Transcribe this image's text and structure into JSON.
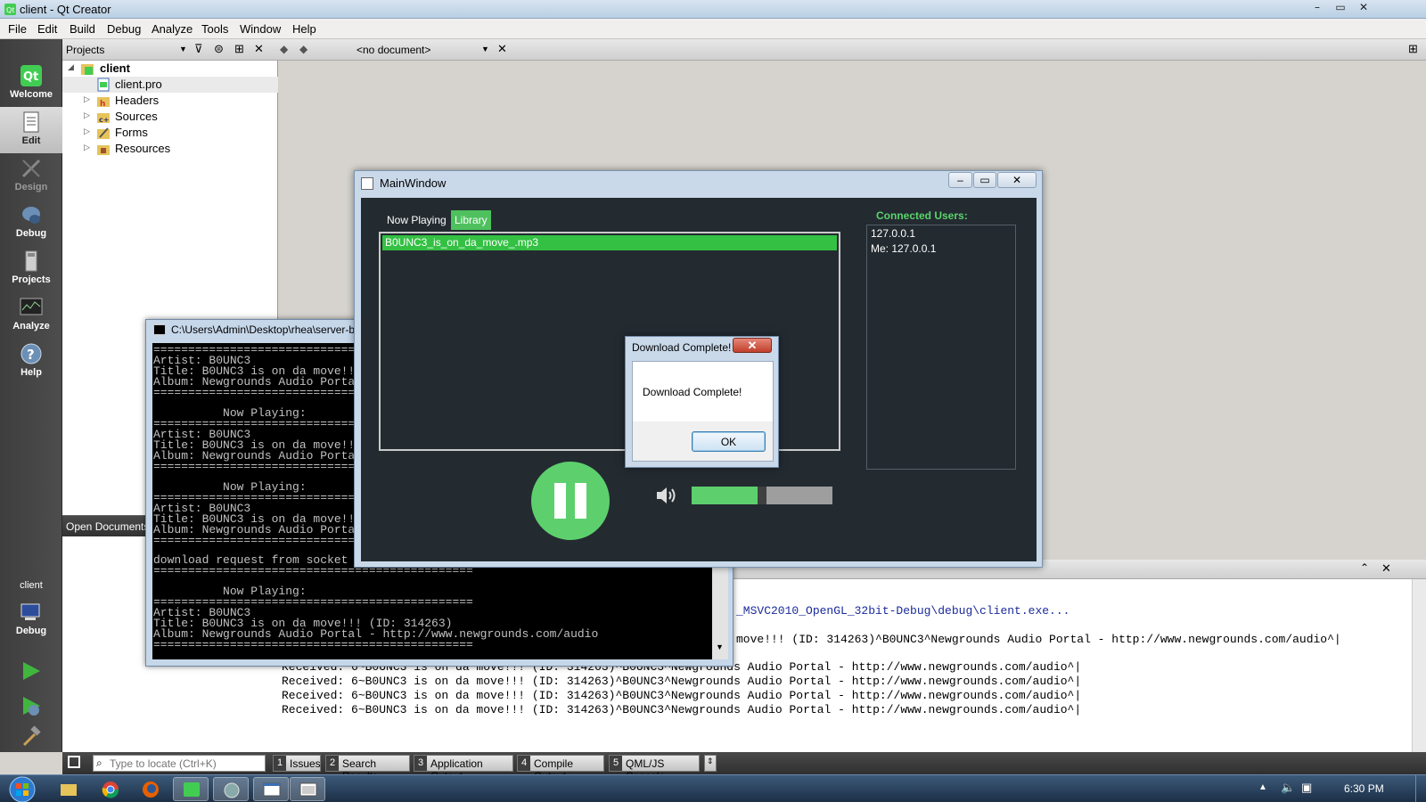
{
  "window": {
    "title": "client - Qt Creator",
    "minimize": "–",
    "maximize": "▭",
    "close": "✕"
  },
  "menu": [
    "File",
    "Edit",
    "Build",
    "Debug",
    "Analyze",
    "Tools",
    "Window",
    "Help"
  ],
  "modes": [
    "Welcome",
    "Edit",
    "Design",
    "Debug",
    "Projects",
    "Analyze",
    "Help"
  ],
  "target": {
    "project": "client",
    "mode": "Debug"
  },
  "projects": {
    "header": "Projects",
    "root": "client",
    "items": [
      "client.pro",
      "Headers",
      "Sources",
      "Forms",
      "Resources"
    ]
  },
  "editor": {
    "document": "<no document>"
  },
  "open_documents": "Open Documents",
  "output": {
    "lines": [
      "_MSVC2010_OpenGL_32bit-Debug\\debug\\client.exe...",
      "move!!! (ID: 314263)^B0UNC3^Newgrounds Audio Portal - http://www.newgrounds.com/audio^|",
      "Received: 6~B0UNC3 is on da move!!! (ID: 314263)^B0UNC3^Newgrounds Audio Portal - http://www.newgrounds.com/audio^|",
      "Received: 6~B0UNC3 is on da move!!! (ID: 314263)^B0UNC3^Newgrounds Audio Portal - http://www.newgrounds.com/audio^|",
      "Received: 6~B0UNC3 is on da move!!! (ID: 314263)^B0UNC3^Newgrounds Audio Portal - http://www.newgrounds.com/audio^|",
      "Received: 6~B0UNC3 is on da move!!! (ID: 314263)^B0UNC3^Newgrounds Audio Portal - http://www.newgrounds.com/audio^|"
    ]
  },
  "locator": {
    "placeholder": "Type to locate (Ctrl+K)"
  },
  "panes": [
    {
      "num": "1",
      "label": "Issues"
    },
    {
      "num": "2",
      "label": "Search Results"
    },
    {
      "num": "3",
      "label": "Application Output"
    },
    {
      "num": "4",
      "label": "Compile Output"
    },
    {
      "num": "5",
      "label": "QML/JS Console"
    }
  ],
  "console": {
    "title": "C:\\Users\\Admin\\Desktop\\rhea\\server-b",
    "lines": [
      "==============================================",
      "Artist: B0UNC3",
      "Title: B0UNC3 is on da move!!! (ID: 314263)",
      "Album: Newgrounds Audio Portal - http://www.newgrounds.com/audio",
      "==============================================",
      "          Now Playing:",
      "==============================================",
      "Artist: B0UNC3",
      "Title: B0UNC3 is on da move!!! (ID: 314263)",
      "Album: Newgrounds Audio Portal - http://www.newgrounds.com/audio",
      "==============================================",
      "          Now Playing:",
      "==============================================",
      "Artist: B0UNC3",
      "Title: B0UNC3 is on da move!!! (ID: 314263)",
      "Album: Newgrounds Audio Portal - http://www.newgrounds.com/audio",
      "==============================================",
      "download request from socket",
      "==============================================",
      "          Now Playing:",
      "==============================================",
      "Artist: B0UNC3",
      "Title: B0UNC3 is on da move!!! (ID: 314263)",
      "Album: Newgrounds Audio Portal - http://www.newgrounds.com/audio",
      "=============================================="
    ]
  },
  "mainwindow": {
    "title": "MainWindow",
    "tabs": [
      "Now Playing",
      "Library"
    ],
    "selected_tab": "Library",
    "songs": [
      "B0UNC3_is_on_da_move_.mp3"
    ],
    "users_header": "Connected Users:",
    "users": [
      "127.0.0.1",
      "Me: 127.0.0.1"
    ],
    "volume_fraction": 0.47,
    "accent": "#5dd06d"
  },
  "dialog": {
    "title": "Download Complete!",
    "message": "Download Complete!",
    "ok": "OK",
    "close": "✕"
  },
  "taskbar": {
    "clock": "6:30 PM"
  }
}
